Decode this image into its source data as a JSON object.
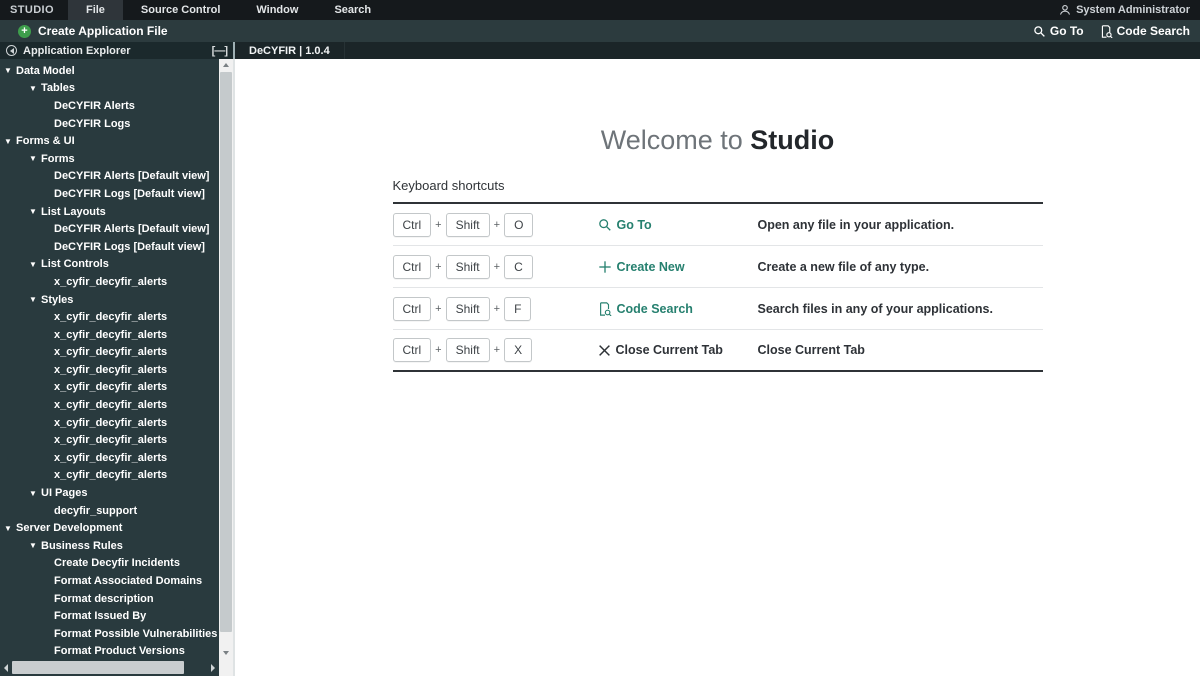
{
  "topbar": {
    "brand": "STUDIO",
    "menus": [
      {
        "label": "File",
        "active": true
      },
      {
        "label": "Source Control",
        "active": false
      },
      {
        "label": "Window",
        "active": false
      },
      {
        "label": "Search",
        "active": false
      }
    ],
    "user": "System Administrator"
  },
  "toolbar": {
    "create_label": "Create Application File",
    "goto_label": "Go To",
    "code_search_label": "Code Search"
  },
  "explorer": {
    "title": "Application Explorer",
    "collapse_label": "[—]"
  },
  "tabs": {
    "active": "DeCYFIR | 1.0.4"
  },
  "tree": [
    {
      "label": "Data Model",
      "level": 0,
      "group": true
    },
    {
      "label": "Tables",
      "level": 1,
      "group": true
    },
    {
      "label": "DeCYFIR Alerts",
      "level": 2,
      "group": false
    },
    {
      "label": "DeCYFIR Logs",
      "level": 2,
      "group": false
    },
    {
      "label": "Forms & UI",
      "level": 0,
      "group": true
    },
    {
      "label": "Forms",
      "level": 1,
      "group": true
    },
    {
      "label": "DeCYFIR Alerts [Default view]",
      "level": 2,
      "group": false
    },
    {
      "label": "DeCYFIR Logs [Default view]",
      "level": 2,
      "group": false
    },
    {
      "label": "List Layouts",
      "level": 1,
      "group": true
    },
    {
      "label": "DeCYFIR Alerts [Default view]",
      "level": 2,
      "group": false
    },
    {
      "label": "DeCYFIR Logs [Default view]",
      "level": 2,
      "group": false
    },
    {
      "label": "List Controls",
      "level": 1,
      "group": true
    },
    {
      "label": "x_cyfir_decyfir_alerts",
      "level": 2,
      "group": false
    },
    {
      "label": "Styles",
      "level": 1,
      "group": true
    },
    {
      "label": "x_cyfir_decyfir_alerts",
      "level": 2,
      "group": false
    },
    {
      "label": "x_cyfir_decyfir_alerts",
      "level": 2,
      "group": false
    },
    {
      "label": "x_cyfir_decyfir_alerts",
      "level": 2,
      "group": false
    },
    {
      "label": "x_cyfir_decyfir_alerts",
      "level": 2,
      "group": false
    },
    {
      "label": "x_cyfir_decyfir_alerts",
      "level": 2,
      "group": false
    },
    {
      "label": "x_cyfir_decyfir_alerts",
      "level": 2,
      "group": false
    },
    {
      "label": "x_cyfir_decyfir_alerts",
      "level": 2,
      "group": false
    },
    {
      "label": "x_cyfir_decyfir_alerts",
      "level": 2,
      "group": false
    },
    {
      "label": "x_cyfir_decyfir_alerts",
      "level": 2,
      "group": false
    },
    {
      "label": "x_cyfir_decyfir_alerts",
      "level": 2,
      "group": false
    },
    {
      "label": "UI Pages",
      "level": 1,
      "group": true
    },
    {
      "label": "decyfir_support",
      "level": 2,
      "group": false
    },
    {
      "label": "Server Development",
      "level": 0,
      "group": true
    },
    {
      "label": "Business Rules",
      "level": 1,
      "group": true
    },
    {
      "label": "Create Decyfir Incidents",
      "level": 2,
      "group": false
    },
    {
      "label": "Format Associated Domains",
      "level": 2,
      "group": false
    },
    {
      "label": "Format description",
      "level": 2,
      "group": false
    },
    {
      "label": "Format Issued By",
      "level": 2,
      "group": false
    },
    {
      "label": "Format Possible Vulnerabilities",
      "level": 2,
      "group": false
    },
    {
      "label": "Format Product Versions",
      "level": 2,
      "group": false
    }
  ],
  "welcome": {
    "prefix": "Welcome to",
    "brand": "Studio"
  },
  "shortcuts": {
    "heading": "Keyboard shortcuts",
    "rows": [
      {
        "keys": [
          "Ctrl",
          "Shift",
          "O"
        ],
        "action": "Go To",
        "icon": "search-icon",
        "desc": "Open any file in your application.",
        "accent": true
      },
      {
        "keys": [
          "Ctrl",
          "Shift",
          "C"
        ],
        "action": "Create New",
        "icon": "plus-icon",
        "desc": "Create a new file of any type.",
        "accent": true
      },
      {
        "keys": [
          "Ctrl",
          "Shift",
          "F"
        ],
        "action": "Code Search",
        "icon": "code-search-icon",
        "desc": "Search files in any of your applications.",
        "accent": true
      },
      {
        "keys": [
          "Ctrl",
          "Shift",
          "X"
        ],
        "action": "Close Current Tab",
        "icon": "close-icon",
        "desc": "Close Current Tab",
        "accent": false
      }
    ]
  },
  "colors": {
    "accent_teal": "#26806f",
    "green_plus": "#3e9e4c",
    "topbar_bg": "#15191c",
    "sidebar_bg": "#293a3e",
    "explorer_head_bg": "#1b292c",
    "toolbar_bg": "#2c3b3e"
  }
}
